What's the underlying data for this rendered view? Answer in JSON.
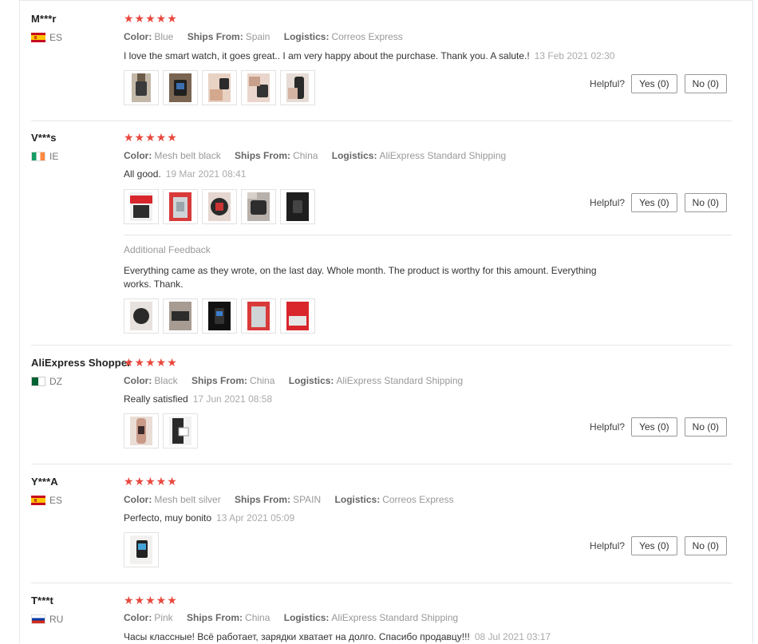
{
  "reviews": [
    {
      "user": "M***r",
      "country": "ES",
      "stars": "★★★★★",
      "props": [
        {
          "k": "Color:",
          "v": "Blue"
        },
        {
          "k": "Ships From:",
          "v": "Spain"
        },
        {
          "k": "Logistics:",
          "v": "Correos Express"
        }
      ],
      "text": "I love the smart watch, it goes great.. I am very happy about the purchase. Thank you. A salute.!",
      "date": "13 Feb 2021 02:30",
      "helpful": {
        "label": "Helpful?",
        "yes": "Yes (0)",
        "no": "No (0)"
      }
    },
    {
      "user": "V***s",
      "country": "IE",
      "stars": "★★★★★",
      "props": [
        {
          "k": "Color:",
          "v": "Mesh belt black"
        },
        {
          "k": "Ships From:",
          "v": "China"
        },
        {
          "k": "Logistics:",
          "v": "AliExpress Standard Shipping"
        }
      ],
      "text": "All good.",
      "date": "19 Mar 2021 08:41",
      "helpful": {
        "label": "Helpful?",
        "yes": "Yes (0)",
        "no": "No (0)"
      },
      "additional": {
        "title": "Additional Feedback",
        "text_line1": "Everything came as they wrote, on the last day. Whole month. The product is worthy for this amount. Everything",
        "text_line2": "works. Thank."
      }
    },
    {
      "user": "AliExpress Shopper",
      "country": "DZ",
      "stars": "★★★★★",
      "props": [
        {
          "k": "Color:",
          "v": "Black"
        },
        {
          "k": "Ships From:",
          "v": "China"
        },
        {
          "k": "Logistics:",
          "v": "AliExpress Standard Shipping"
        }
      ],
      "text": "Really satisfied",
      "date": "17 Jun 2021 08:58",
      "helpful": {
        "label": "Helpful?",
        "yes": "Yes (0)",
        "no": "No (0)"
      }
    },
    {
      "user": "Y***A",
      "country": "ES",
      "stars": "★★★★★",
      "props": [
        {
          "k": "Color:",
          "v": "Mesh belt silver"
        },
        {
          "k": "Ships From:",
          "v": "SPAIN"
        },
        {
          "k": "Logistics:",
          "v": "Correos Express"
        }
      ],
      "text": "Perfecto, muy bonito",
      "date": "13 Apr 2021 05:09",
      "helpful": {
        "label": "Helpful?",
        "yes": "Yes (0)",
        "no": "No (0)"
      }
    },
    {
      "user": "T***t",
      "country": "RU",
      "stars": "★★★★★",
      "props": [
        {
          "k": "Color:",
          "v": "Pink"
        },
        {
          "k": "Ships From:",
          "v": "China"
        },
        {
          "k": "Logistics:",
          "v": "AliExpress Standard Shipping"
        }
      ],
      "text": "Часы классные! Всё работает, зарядки хватает на долго. Спасибо продавцу!!!",
      "date": "08 Jul 2021 03:17"
    }
  ],
  "colors": {
    "star": "#e8483e",
    "border": "#e6e6e6"
  }
}
